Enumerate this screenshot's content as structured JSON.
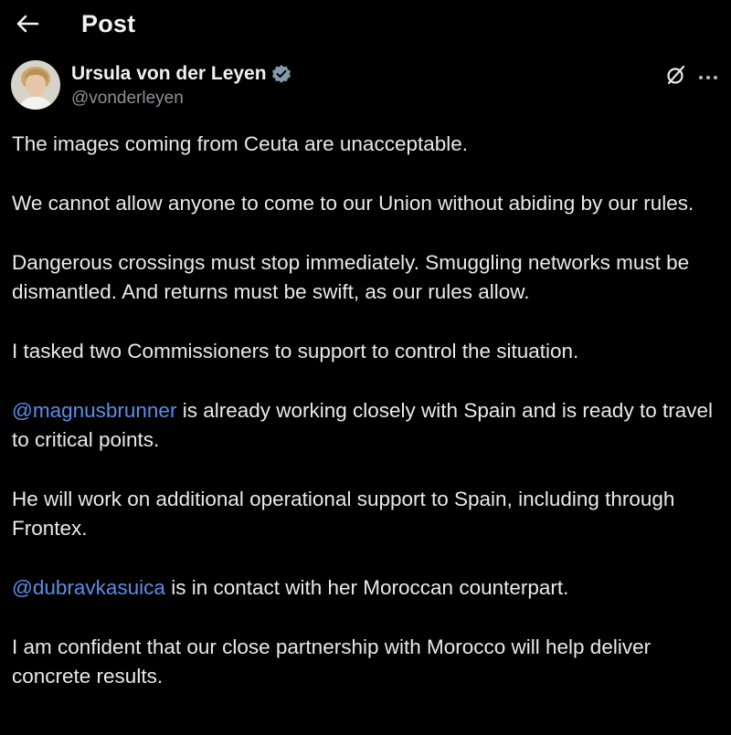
{
  "header": {
    "title": "Post",
    "back_icon": "arrow-left-icon"
  },
  "author": {
    "name": "Ursula von der Leyen",
    "handle": "@vonderleyen",
    "verified_icon": "verified-badge-icon",
    "verified_color": "#829aab"
  },
  "actions": {
    "grok_icon": "grok-icon",
    "more_icon": "more-horizontal-icon"
  },
  "post": {
    "p1": "The images coming from Ceuta are unacceptable.",
    "p2": "We cannot allow anyone to come to our Union without abiding by our rules.",
    "p3": "Dangerous crossings must stop immediately. Smuggling networks must be dismantled. And returns must be swift, as our rules allow.",
    "p4": "I tasked two Commissioners to support to control the situation.",
    "p5_mention": "@magnusbrunner",
    "p5_text": " is already working closely with Spain and is ready to travel to critical points.",
    "p6": "He will work on additional operational support to Spain, including through Frontex.",
    "p7_mention": "@dubravkasuica",
    "p7_text": " is in contact with her Moroccan counterpart.",
    "p8": "I am confident that our close partnership with Morocco will help deliver concrete results."
  },
  "colors": {
    "background": "#000000",
    "text": "#e7e9ea",
    "secondary_text": "#8b9198",
    "mention": "#5b8ee6"
  }
}
